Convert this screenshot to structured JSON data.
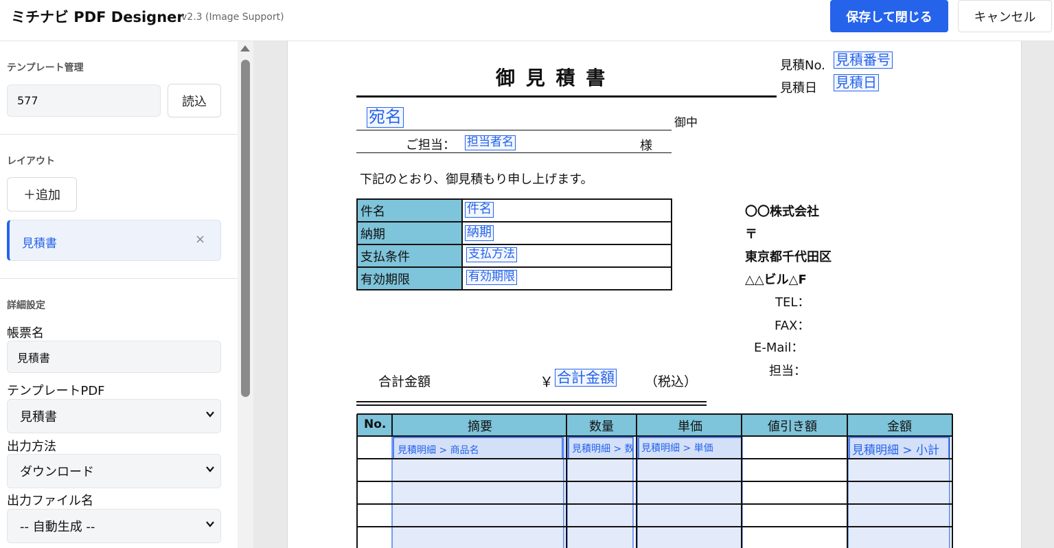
{
  "header": {
    "app_title": "ミチナビ PDF Designer",
    "app_version": "v2.3 (Image Support)",
    "save_label": "保存して閉じる",
    "cancel_label": "キャンセル"
  },
  "sidebar": {
    "template_section_title": "テンプレート管理",
    "template_id_value": "577",
    "load_label": "読込",
    "layout_section_title": "レイアウト",
    "add_label": "＋追加",
    "layout_items": [
      {
        "label": "見積書",
        "close": "×"
      }
    ],
    "detail_section_title": "詳細設定",
    "form_name_label": "帳票名",
    "form_name_value": "見積書",
    "template_pdf_label": "テンプレートPDF",
    "template_pdf_value": "見積書",
    "output_method_label": "出力方法",
    "output_method_value": "ダウンロード",
    "output_filename_label": "出力ファイル名",
    "output_filename_value": "-- 自動生成 --"
  },
  "document": {
    "title": "御 見 積 書",
    "quote_no_label": "見積No.",
    "quote_no_field": "見積番号",
    "quote_date_label": "見積日",
    "quote_date_field": "見積日",
    "addressee_field": "宛名",
    "onchu": "御中",
    "contact_label": "ご担当：",
    "contact_field": "担当者名",
    "sama": "様",
    "intro": "下記のとおり、御見積もり申し上げます。",
    "info_rows": [
      {
        "label": "件名",
        "field": "件名"
      },
      {
        "label": "納期",
        "field": "納期"
      },
      {
        "label": "支払条件",
        "field": "支払方法"
      },
      {
        "label": "有効期限",
        "field": "有効期限"
      }
    ],
    "company": {
      "name": "〇〇株式会社",
      "postal": "〒",
      "address1": "東京都千代田区",
      "address2": "△△ビル△F",
      "tel": "TEL：",
      "fax": "FAX：",
      "email": "E-Mail：",
      "person": "担当："
    },
    "total_label": "合計金額",
    "yen": "￥",
    "total_field": "合計金額",
    "tax_note": "（税込）",
    "table_headers": [
      "No.",
      "摘要",
      "数量",
      "単価",
      "値引き額",
      "金額"
    ],
    "detail_fields": {
      "name": "見積明細 > 商品名",
      "qty": "見積明細 > 数",
      "price": "見積明細 > 単価",
      "amount": "見積明細 > 小計"
    }
  },
  "colors": {
    "accent": "#2563eb",
    "table_header": "#7ec4da",
    "field_fill": "#dce6f9"
  }
}
